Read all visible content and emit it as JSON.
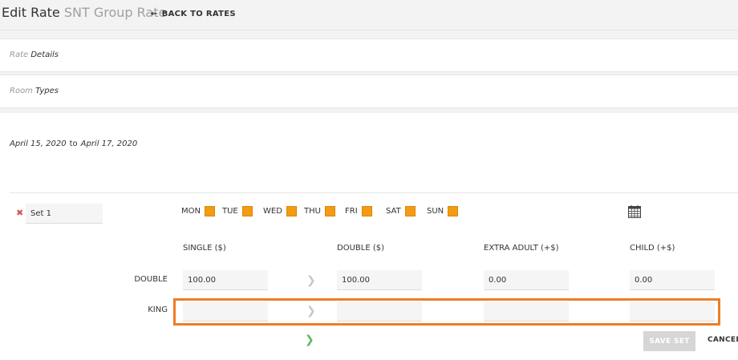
{
  "header": {
    "title": "Edit Rate",
    "subtitle": "SNT Group Rate",
    "back_label": "BACK TO RATES"
  },
  "sections": {
    "rate_details": {
      "muted": "Rate",
      "label": "Details"
    },
    "room_types": {
      "muted": "Room",
      "label": "Types"
    }
  },
  "date_range": {
    "start": "April 15, 2020",
    "separator": "to",
    "end": "April 17, 2020"
  },
  "set": {
    "name": "Set 1",
    "days": [
      "MON",
      "TUE",
      "WED",
      "THU",
      "FRI",
      "SAT",
      "SUN"
    ],
    "columns": [
      "SINGLE ($)",
      "DOUBLE ($)",
      "EXTRA ADULT (+$)",
      "CHILD (+$)"
    ],
    "rows": [
      {
        "label": "DOUBLE",
        "single": "100.00",
        "double": "100.00",
        "extra_adult": "0.00",
        "child": "0.00"
      },
      {
        "label": "KING",
        "single": "",
        "double": "",
        "extra_adult": "",
        "child": ""
      }
    ]
  },
  "actions": {
    "save_label": "SAVE SET",
    "cancel_label": "CANCEL"
  },
  "colors": {
    "accent": "#f39c12",
    "highlight": "#ee7d26",
    "remove": "#d9534f",
    "next": "#5cb85c"
  },
  "icons": {
    "remove": "close-icon",
    "calendar": "calendar-icon",
    "back": "arrow-left-icon",
    "copy_right": "chevron-right-icon",
    "next": "chevron-right-green-icon"
  }
}
